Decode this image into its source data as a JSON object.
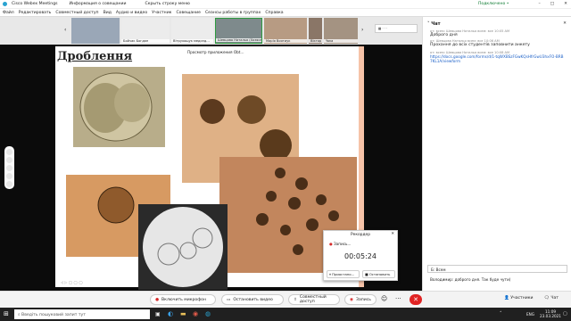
{
  "titlebar": {
    "app": "Cisco Webex Meetings",
    "info": "Информация о совещании",
    "hide": "Скрыть строку меню",
    "presenter": "Подключено •"
  },
  "menu": [
    "Файл",
    "Редактировать",
    "Совместный доступ",
    "Вид",
    "Аудио и видео",
    "Участник",
    "Совещание",
    "Сеансы работы в группах",
    "Справка"
  ],
  "thumbnails": [
    "Бойчак Богдан",
    "Вітрухощук медсед…",
    "Шевцова Наталья (Хозяин)",
    "Марія Воятиук",
    "Віктор",
    "Yana"
  ],
  "slide": {
    "title": "Дроблення",
    "viewer": "Просмотр приложения Obt…"
  },
  "chat": {
    "header": "Чат",
    "messages": [
      {
        "meta": "от: всем:  Шевцова Наталья всем: все   10:05 AM",
        "text": "Доброго дня"
      },
      {
        "meta": "от: Шевцова Наталья всем: все   10:06 AM",
        "text": "Прохання до всіх студентів заповнити анкету"
      },
      {
        "meta": "от: всем: Шевцова Наталья всем: все   10:08 AM",
        "text": "https://docs.google.com/forms/d/1-tqWXBSzFGwKQsHfrGwU3hxFO-BRB7KL1A/viewform"
      }
    ],
    "to_label": "Всем",
    "input_text": "Володимир: доброго дня. Так буде чути)"
  },
  "controls": {
    "mic": "Включить микрофон",
    "video": "Остановить видео",
    "share": "Совместный доступ",
    "record": "Запись",
    "participants": "Участники",
    "chat": "Чат"
  },
  "recorder": {
    "title": "Рекордер",
    "status": "Запись...",
    "time": "00:05:24",
    "pause": "Приостано…",
    "stop": "Остановить"
  },
  "taskbar": {
    "search": "Введіть пошуковий запит тут",
    "time": "11:09",
    "date": "23.03.2021",
    "lang": "ENG"
  }
}
